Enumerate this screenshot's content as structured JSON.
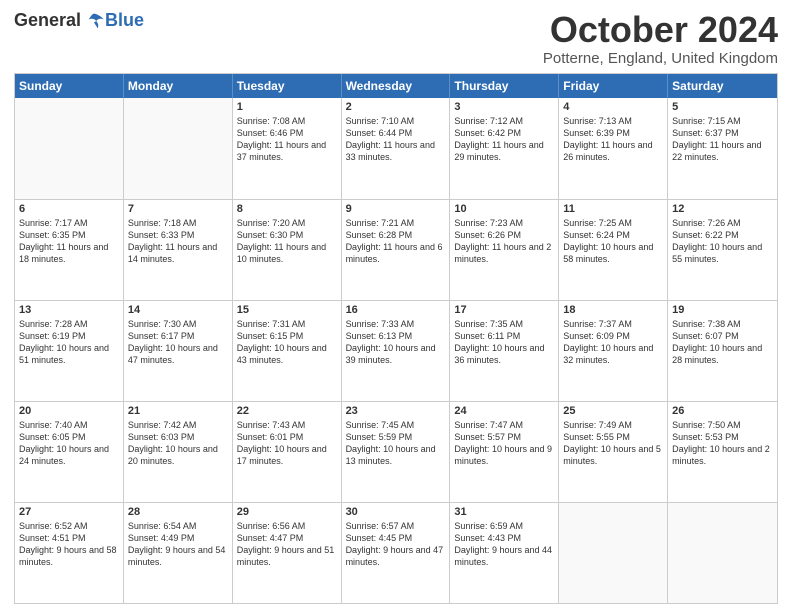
{
  "logo": {
    "general": "General",
    "blue": "Blue"
  },
  "title": "October 2024",
  "location": "Potterne, England, United Kingdom",
  "days": [
    "Sunday",
    "Monday",
    "Tuesday",
    "Wednesday",
    "Thursday",
    "Friday",
    "Saturday"
  ],
  "weeks": [
    [
      {
        "day": "",
        "content": ""
      },
      {
        "day": "",
        "content": ""
      },
      {
        "day": "1",
        "sunrise": "Sunrise: 7:08 AM",
        "sunset": "Sunset: 6:46 PM",
        "daylight": "Daylight: 11 hours and 37 minutes."
      },
      {
        "day": "2",
        "sunrise": "Sunrise: 7:10 AM",
        "sunset": "Sunset: 6:44 PM",
        "daylight": "Daylight: 11 hours and 33 minutes."
      },
      {
        "day": "3",
        "sunrise": "Sunrise: 7:12 AM",
        "sunset": "Sunset: 6:42 PM",
        "daylight": "Daylight: 11 hours and 29 minutes."
      },
      {
        "day": "4",
        "sunrise": "Sunrise: 7:13 AM",
        "sunset": "Sunset: 6:39 PM",
        "daylight": "Daylight: 11 hours and 26 minutes."
      },
      {
        "day": "5",
        "sunrise": "Sunrise: 7:15 AM",
        "sunset": "Sunset: 6:37 PM",
        "daylight": "Daylight: 11 hours and 22 minutes."
      }
    ],
    [
      {
        "day": "6",
        "sunrise": "Sunrise: 7:17 AM",
        "sunset": "Sunset: 6:35 PM",
        "daylight": "Daylight: 11 hours and 18 minutes."
      },
      {
        "day": "7",
        "sunrise": "Sunrise: 7:18 AM",
        "sunset": "Sunset: 6:33 PM",
        "daylight": "Daylight: 11 hours and 14 minutes."
      },
      {
        "day": "8",
        "sunrise": "Sunrise: 7:20 AM",
        "sunset": "Sunset: 6:30 PM",
        "daylight": "Daylight: 11 hours and 10 minutes."
      },
      {
        "day": "9",
        "sunrise": "Sunrise: 7:21 AM",
        "sunset": "Sunset: 6:28 PM",
        "daylight": "Daylight: 11 hours and 6 minutes."
      },
      {
        "day": "10",
        "sunrise": "Sunrise: 7:23 AM",
        "sunset": "Sunset: 6:26 PM",
        "daylight": "Daylight: 11 hours and 2 minutes."
      },
      {
        "day": "11",
        "sunrise": "Sunrise: 7:25 AM",
        "sunset": "Sunset: 6:24 PM",
        "daylight": "Daylight: 10 hours and 58 minutes."
      },
      {
        "day": "12",
        "sunrise": "Sunrise: 7:26 AM",
        "sunset": "Sunset: 6:22 PM",
        "daylight": "Daylight: 10 hours and 55 minutes."
      }
    ],
    [
      {
        "day": "13",
        "sunrise": "Sunrise: 7:28 AM",
        "sunset": "Sunset: 6:19 PM",
        "daylight": "Daylight: 10 hours and 51 minutes."
      },
      {
        "day": "14",
        "sunrise": "Sunrise: 7:30 AM",
        "sunset": "Sunset: 6:17 PM",
        "daylight": "Daylight: 10 hours and 47 minutes."
      },
      {
        "day": "15",
        "sunrise": "Sunrise: 7:31 AM",
        "sunset": "Sunset: 6:15 PM",
        "daylight": "Daylight: 10 hours and 43 minutes."
      },
      {
        "day": "16",
        "sunrise": "Sunrise: 7:33 AM",
        "sunset": "Sunset: 6:13 PM",
        "daylight": "Daylight: 10 hours and 39 minutes."
      },
      {
        "day": "17",
        "sunrise": "Sunrise: 7:35 AM",
        "sunset": "Sunset: 6:11 PM",
        "daylight": "Daylight: 10 hours and 36 minutes."
      },
      {
        "day": "18",
        "sunrise": "Sunrise: 7:37 AM",
        "sunset": "Sunset: 6:09 PM",
        "daylight": "Daylight: 10 hours and 32 minutes."
      },
      {
        "day": "19",
        "sunrise": "Sunrise: 7:38 AM",
        "sunset": "Sunset: 6:07 PM",
        "daylight": "Daylight: 10 hours and 28 minutes."
      }
    ],
    [
      {
        "day": "20",
        "sunrise": "Sunrise: 7:40 AM",
        "sunset": "Sunset: 6:05 PM",
        "daylight": "Daylight: 10 hours and 24 minutes."
      },
      {
        "day": "21",
        "sunrise": "Sunrise: 7:42 AM",
        "sunset": "Sunset: 6:03 PM",
        "daylight": "Daylight: 10 hours and 20 minutes."
      },
      {
        "day": "22",
        "sunrise": "Sunrise: 7:43 AM",
        "sunset": "Sunset: 6:01 PM",
        "daylight": "Daylight: 10 hours and 17 minutes."
      },
      {
        "day": "23",
        "sunrise": "Sunrise: 7:45 AM",
        "sunset": "Sunset: 5:59 PM",
        "daylight": "Daylight: 10 hours and 13 minutes."
      },
      {
        "day": "24",
        "sunrise": "Sunrise: 7:47 AM",
        "sunset": "Sunset: 5:57 PM",
        "daylight": "Daylight: 10 hours and 9 minutes."
      },
      {
        "day": "25",
        "sunrise": "Sunrise: 7:49 AM",
        "sunset": "Sunset: 5:55 PM",
        "daylight": "Daylight: 10 hours and 5 minutes."
      },
      {
        "day": "26",
        "sunrise": "Sunrise: 7:50 AM",
        "sunset": "Sunset: 5:53 PM",
        "daylight": "Daylight: 10 hours and 2 minutes."
      }
    ],
    [
      {
        "day": "27",
        "sunrise": "Sunrise: 6:52 AM",
        "sunset": "Sunset: 4:51 PM",
        "daylight": "Daylight: 9 hours and 58 minutes."
      },
      {
        "day": "28",
        "sunrise": "Sunrise: 6:54 AM",
        "sunset": "Sunset: 4:49 PM",
        "daylight": "Daylight: 9 hours and 54 minutes."
      },
      {
        "day": "29",
        "sunrise": "Sunrise: 6:56 AM",
        "sunset": "Sunset: 4:47 PM",
        "daylight": "Daylight: 9 hours and 51 minutes."
      },
      {
        "day": "30",
        "sunrise": "Sunrise: 6:57 AM",
        "sunset": "Sunset: 4:45 PM",
        "daylight": "Daylight: 9 hours and 47 minutes."
      },
      {
        "day": "31",
        "sunrise": "Sunrise: 6:59 AM",
        "sunset": "Sunset: 4:43 PM",
        "daylight": "Daylight: 9 hours and 44 minutes."
      },
      {
        "day": "",
        "content": ""
      },
      {
        "day": "",
        "content": ""
      }
    ]
  ]
}
